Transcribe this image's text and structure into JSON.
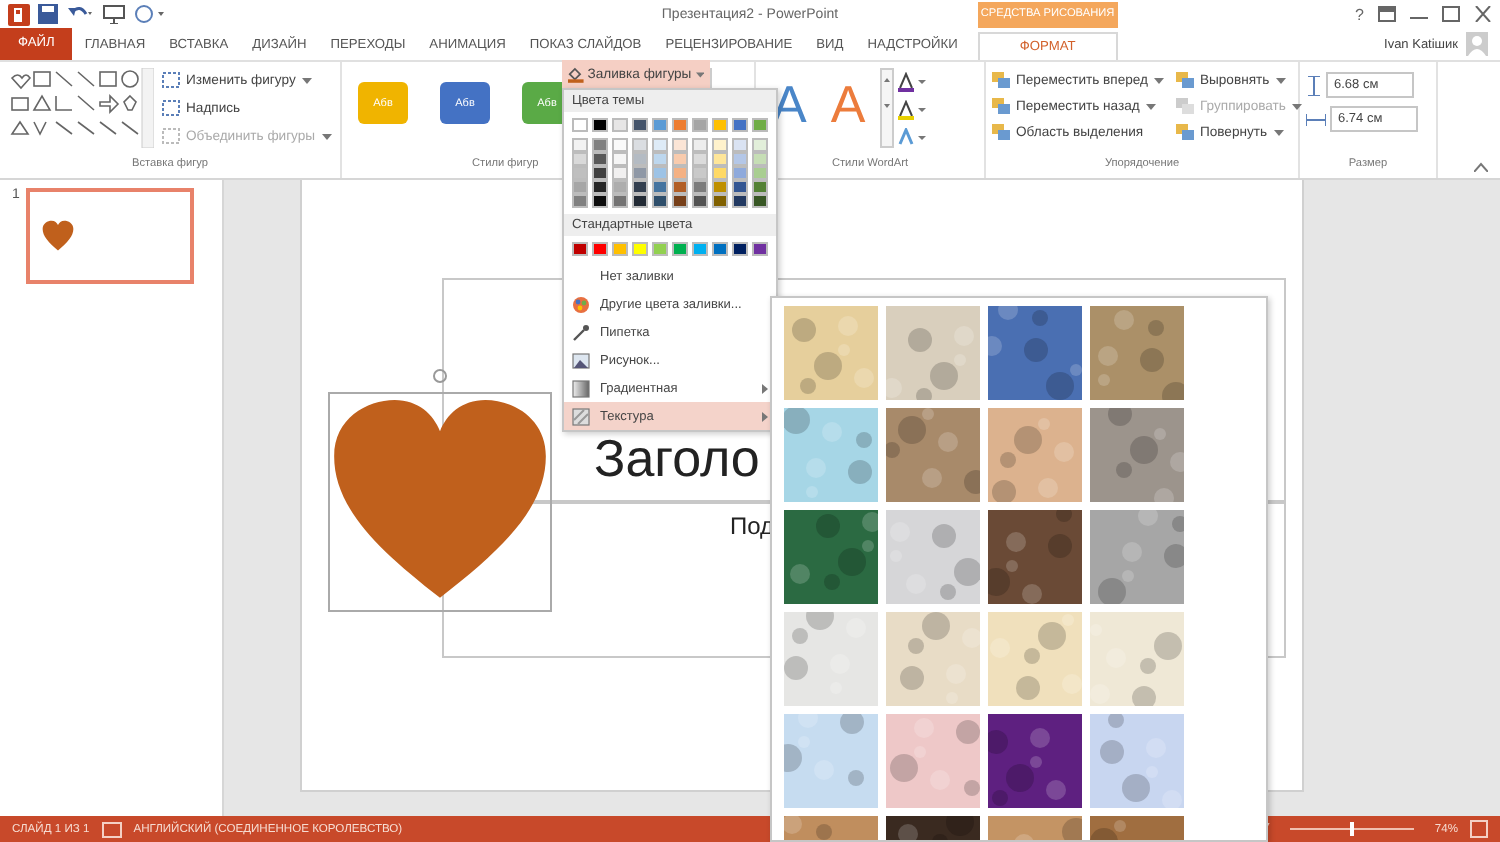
{
  "title_bar": {
    "title": "Презентация2 - PowerPoint",
    "help": "?"
  },
  "contextual_header": "СРЕДСТВА РИСОВАНИЯ",
  "tabs": [
    {
      "label": "ФАЙЛ",
      "kind": "file",
      "selected": false
    },
    {
      "label": "ГЛАВНАЯ",
      "kind": "normal",
      "selected": false
    },
    {
      "label": "ВСТАВКА",
      "kind": "normal",
      "selected": false
    },
    {
      "label": "ДИЗАЙН",
      "kind": "normal",
      "selected": false
    },
    {
      "label": "ПЕРЕХОДЫ",
      "kind": "normal",
      "selected": false
    },
    {
      "label": "АНИМАЦИЯ",
      "kind": "normal",
      "selected": false
    },
    {
      "label": "ПОКАЗ СЛАЙДОВ",
      "kind": "normal",
      "selected": false
    },
    {
      "label": "РЕЦЕНЗИРОВАНИЕ",
      "kind": "normal",
      "selected": false
    },
    {
      "label": "ВИД",
      "kind": "normal",
      "selected": false
    },
    {
      "label": "НАДСТРОЙКИ",
      "kind": "normal",
      "selected": false
    },
    {
      "label": "ФОРМАТ",
      "kind": "contextual",
      "selected": true
    }
  ],
  "user": "Ivan Katiшик",
  "ribbon": {
    "insert_shapes": {
      "label": "Вставка фигур",
      "buttons": [
        {
          "label": "Изменить фигуру",
          "dropdown": true,
          "disabled": false
        },
        {
          "label": "Надпись",
          "dropdown": false,
          "disabled": false
        },
        {
          "label": "Объединить фигуры",
          "dropdown": true,
          "disabled": true
        }
      ]
    },
    "shape_styles": {
      "label": "Стили фигур",
      "styles": [
        {
          "text": "Абв",
          "color": "#f0b400"
        },
        {
          "text": "Абв",
          "color": "#4472c4"
        },
        {
          "text": "Абв",
          "color": "#5aaa46"
        }
      ],
      "fill_button": "Заливка фигуры"
    },
    "wordart": {
      "label": "Стили WordArt",
      "letters": [
        {
          "text": "A",
          "color": "#4a86c8"
        },
        {
          "text": "A",
          "color": "#ec7c3c"
        }
      ]
    },
    "arrange": {
      "label": "Упорядочение",
      "buttons": [
        {
          "label": "Переместить вперед",
          "dropdown": true,
          "disabled": false
        },
        {
          "label": "Переместить назад",
          "dropdown": true,
          "disabled": false
        },
        {
          "label": "Область выделения",
          "dropdown": false,
          "disabled": false
        },
        {
          "label": "Выровнять",
          "dropdown": true,
          "disabled": false
        },
        {
          "label": "Группировать",
          "dropdown": true,
          "disabled": true
        },
        {
          "label": "Повернуть",
          "dropdown": true,
          "disabled": false
        }
      ]
    },
    "size": {
      "label": "Размер",
      "height": "6.68 см",
      "width": "6.74 см"
    }
  },
  "slides_panel": {
    "slides": [
      {
        "number": "1",
        "selected": true
      }
    ]
  },
  "slide": {
    "title": "Заголо",
    "subtitle": "Под"
  },
  "fill_menu": {
    "theme_header": "Цвета темы",
    "theme_colors": [
      {
        "color": "#ffffff"
      },
      {
        "color": "#000000"
      },
      {
        "color": "#e7e6e6"
      },
      {
        "color": "#44546a"
      },
      {
        "color": "#5b9bd5"
      },
      {
        "color": "#ed7d31"
      },
      {
        "color": "#a5a5a5"
      },
      {
        "color": "#ffc000"
      },
      {
        "color": "#4472c4"
      },
      {
        "color": "#70ad47"
      }
    ],
    "standard_header": "Стандартные цвета",
    "standard_colors": [
      {
        "color": "#c00000"
      },
      {
        "color": "#ff0000"
      },
      {
        "color": "#ffc000"
      },
      {
        "color": "#ffff00"
      },
      {
        "color": "#92d050"
      },
      {
        "color": "#00b050"
      },
      {
        "color": "#00b0f0"
      },
      {
        "color": "#0070c0"
      },
      {
        "color": "#002060"
      },
      {
        "color": "#7030a0"
      }
    ],
    "items": [
      {
        "label": "Нет заливки",
        "kind": "none",
        "submenu": false,
        "selected": false
      },
      {
        "label": "Другие цвета заливки...",
        "kind": "palette",
        "submenu": false,
        "selected": false
      },
      {
        "label": "Пипетка",
        "kind": "eyedropper",
        "submenu": false,
        "selected": false
      },
      {
        "label": "Рисунок...",
        "kind": "image",
        "submenu": false,
        "selected": false
      },
      {
        "label": "Градиентная",
        "kind": "gradient",
        "submenu": true,
        "selected": false
      },
      {
        "label": "Текстура",
        "kind": "texture",
        "submenu": true,
        "selected": true
      }
    ]
  },
  "texture_gallery": {
    "textures": [
      {
        "color": "#e6cf9c"
      },
      {
        "color": "#d9cfbd"
      },
      {
        "color": "#4a6fb2"
      },
      {
        "color": "#ab9068"
      },
      {
        "color": "#a6d6e6"
      },
      {
        "color": "#a88a6a"
      },
      {
        "color": "#dcb28e"
      },
      {
        "color": "#9c948c"
      },
      {
        "color": "#2b6a42"
      },
      {
        "color": "#d6d6d8"
      },
      {
        "color": "#6a4a36"
      },
      {
        "color": "#a6a6a6"
      },
      {
        "color": "#e6e6e4"
      },
      {
        "color": "#e8dcc6"
      },
      {
        "color": "#f0e0bc"
      },
      {
        "color": "#efe8d6"
      },
      {
        "color": "#c6dcf0"
      },
      {
        "color": "#eec8c8"
      },
      {
        "color": "#5e2080"
      },
      {
        "color": "#c8d6f0"
      },
      {
        "color": "#c08e5e"
      },
      {
        "color": "#3a2a20"
      },
      {
        "color": "#c49464"
      },
      {
        "color": "#a06e40"
      }
    ]
  },
  "status_bar": {
    "slide": "СЛАЙД 1 ИЗ 1",
    "language": "АНГЛИЙСКИЙ (СОЕДИНЕННОЕ КОРОЛЕВСТВО)",
    "zoom": "74%",
    "zoom_slider": {
      "level": 0.5
    }
  }
}
